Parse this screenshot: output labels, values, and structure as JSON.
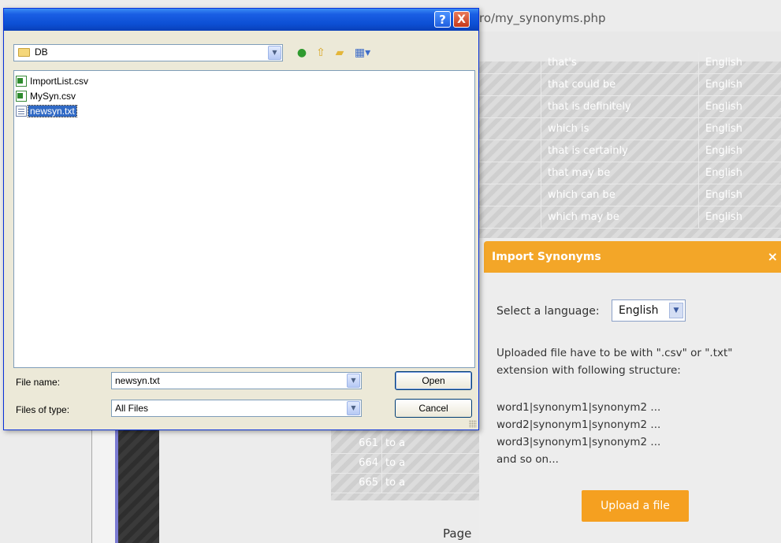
{
  "browser": {
    "url_fragment": "ro/my_synonyms.php"
  },
  "synonyms_table": {
    "rows": [
      {
        "word": "that's",
        "language": "English"
      },
      {
        "word": "that could be",
        "language": "English"
      },
      {
        "word": "that is definitely",
        "language": "English"
      },
      {
        "word": "which is",
        "language": "English"
      },
      {
        "word": "that is certainly",
        "language": "English"
      },
      {
        "word": "that may be",
        "language": "English"
      },
      {
        "word": "which can be",
        "language": "English"
      },
      {
        "word": "which may be",
        "language": "English"
      }
    ]
  },
  "lower_table": {
    "rows": [
      {
        "num": "661",
        "text": "to a"
      },
      {
        "num": "664",
        "text": "to a"
      },
      {
        "num": "665",
        "text": "to a"
      }
    ]
  },
  "page_label": "Page",
  "modal": {
    "title": "Import Synonyms",
    "close_icon": "×",
    "language_label": "Select a language:",
    "language_value": "English",
    "instructions_line1": "Uploaded file have to be with \".csv\" or \".txt\"",
    "instructions_line2": "extension with following structure:",
    "example_line1": "word1|synonym1|synonym2 ...",
    "example_line2": "word2|synonym1|synonym2 ...",
    "example_line3": "word3|synonym1|synonym2 ...",
    "example_line4": "and so on...",
    "upload_button": "Upload a file",
    "accent_color": "#f3a628"
  },
  "file_dialog": {
    "help_label": "?",
    "close_label": "X",
    "look_in": "DB",
    "toolbar_icons": [
      "back-icon",
      "up-folder-icon",
      "new-folder-icon",
      "views-menu-icon"
    ],
    "files": [
      {
        "name": "ImportList.csv",
        "type": "csv-icon",
        "selected": false
      },
      {
        "name": "MySyn.csv",
        "type": "csv-icon",
        "selected": false
      },
      {
        "name": "newsyn.txt",
        "type": "txt-icon",
        "selected": true
      }
    ],
    "file_name_label": "File name:",
    "file_name_value": "newsyn.txt",
    "file_type_label": "Files of type:",
    "file_type_value": "All Files",
    "open_button": "Open",
    "cancel_button": "Cancel",
    "title_color": "#0c4fd4"
  }
}
